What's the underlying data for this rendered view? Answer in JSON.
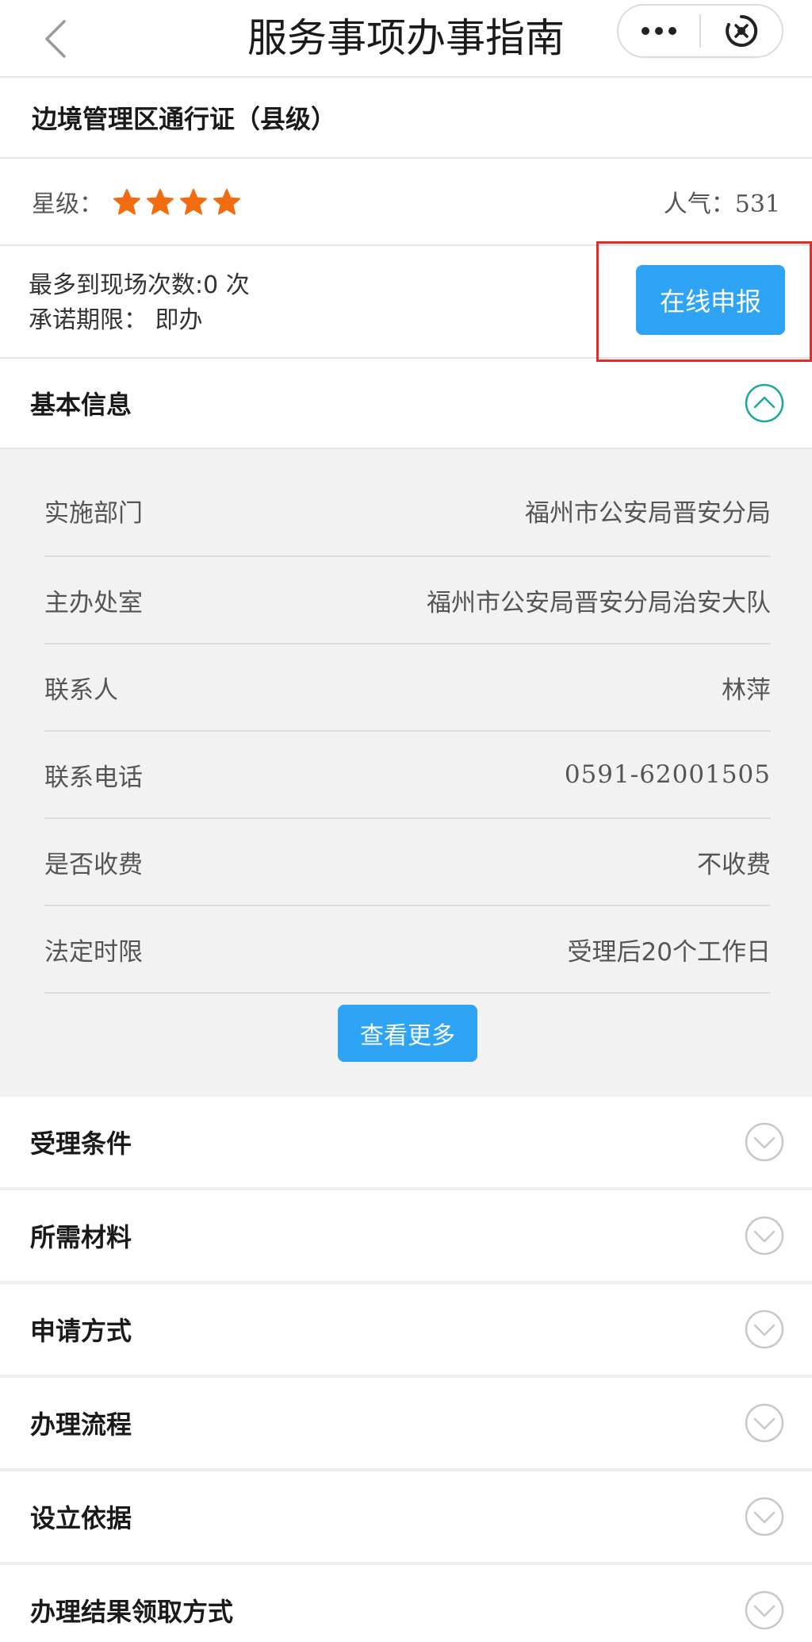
{
  "navbar": {
    "title": "服务事项办事指南",
    "back_icon": "chevron-left-icon",
    "more_icon": "more-dots-icon",
    "close_icon": "close-circle-icon"
  },
  "item": {
    "title": "边境管理区通行证（县级）"
  },
  "rating": {
    "star_label": "星级：",
    "stars": 4,
    "star_color": "#f26b0f",
    "popularity_label": "人气：",
    "popularity_value": "531"
  },
  "visits": {
    "max_visits": "最多到现场次数:0 次",
    "deadline": "承诺期限：  即办"
  },
  "apply_button": {
    "label": "在线申报",
    "color": "#2fa4f4",
    "highlight_color": "#e62b2b"
  },
  "basic_info": {
    "title": "基本信息",
    "expanded": true,
    "accent_color": "#1fa89a",
    "rows": [
      {
        "label": "实施部门",
        "value": "福州市公安局晋安分局"
      },
      {
        "label": "主办处室",
        "value": "福州市公安局晋安分局治安大队"
      },
      {
        "label": "联系人",
        "value": "林萍"
      },
      {
        "label": "联系电话",
        "value": "0591-62001505"
      },
      {
        "label": "是否收费",
        "value": "不收费"
      },
      {
        "label": "法定时限",
        "value": "受理后20个工作日"
      }
    ],
    "more_label": "查看更多"
  },
  "sections": [
    {
      "title": "受理条件"
    },
    {
      "title": "所需材料"
    },
    {
      "title": "申请方式"
    },
    {
      "title": "办理流程"
    },
    {
      "title": "设立依据"
    },
    {
      "title": "办理结果领取方式"
    }
  ]
}
